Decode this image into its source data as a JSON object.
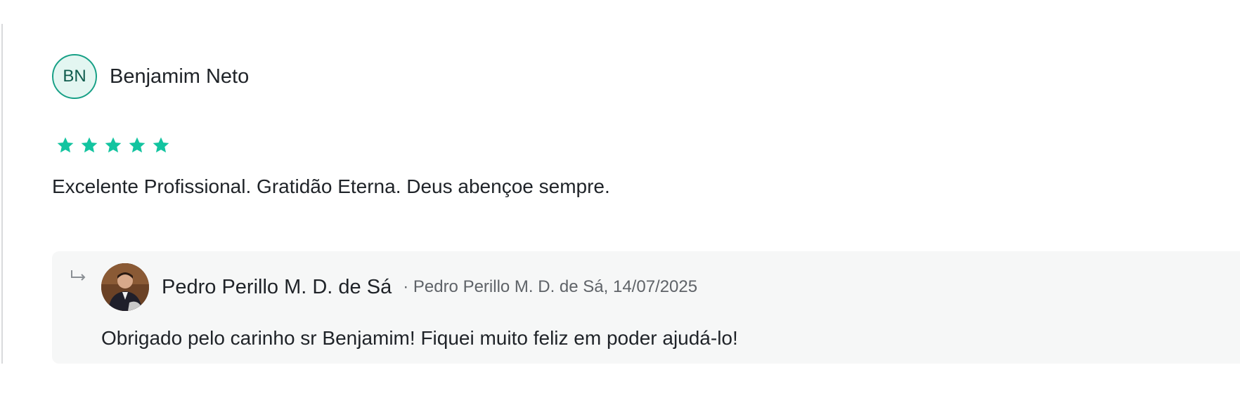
{
  "review": {
    "reviewer": {
      "initials": "BN",
      "name": "Benjamim Neto"
    },
    "rating": {
      "value": 5,
      "max": 5
    },
    "text": "Excelente Profissional. Gratidão Eterna. Deus abençoe sempre.",
    "colors": {
      "accent": "#17a086",
      "star": "#13c4a0",
      "avatar_bg": "#e3f6f1"
    }
  },
  "reply": {
    "icon": "reply-arrow-icon",
    "author": "Pedro Perillo M. D. de Sá",
    "meta": "· Pedro Perillo M. D. de Sá, 14/07/2025",
    "text": "Obrigado pelo carinho sr Benjamim! Fiquei muito feliz em poder ajudá-lo!"
  }
}
